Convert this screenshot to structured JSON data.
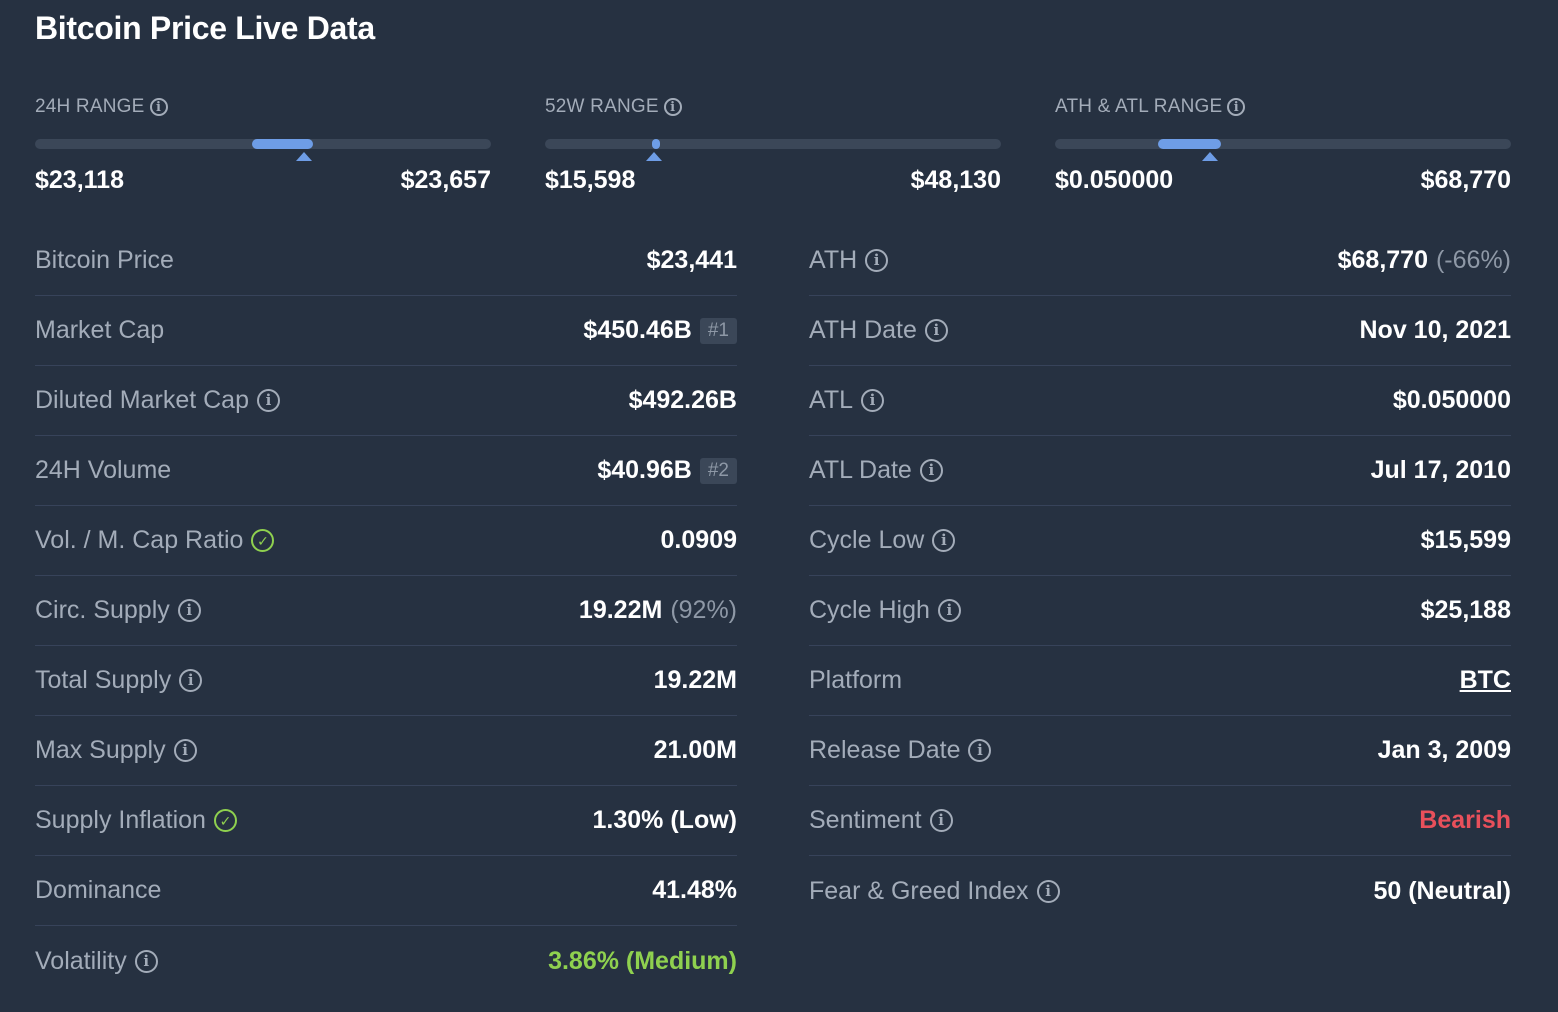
{
  "title": "Bitcoin Price Live Data",
  "ranges": [
    {
      "label": "24H RANGE",
      "low": "$23,118",
      "high": "$23,657",
      "fill_start": 0.475,
      "fill_end": 0.61,
      "marker": 0.59
    },
    {
      "label": "52W RANGE",
      "low": "$15,598",
      "high": "$48,130",
      "fill_start": 0.235,
      "fill_end": 0.25,
      "marker": 0.24
    },
    {
      "label": "ATH & ATL RANGE",
      "low": "$0.050000",
      "high": "$68,770",
      "fill_start": 0.225,
      "fill_end": 0.365,
      "marker": 0.34
    }
  ],
  "accent_color": "#6e9de6",
  "left_rows": [
    {
      "label": "Bitcoin Price",
      "value": "$23,441"
    },
    {
      "label": "Market Cap",
      "value": "$450.46B",
      "badge": "#1"
    },
    {
      "label": "Diluted Market Cap",
      "icon": "info-icon",
      "value": "$492.26B"
    },
    {
      "label": "24H Volume",
      "value": "$40.96B",
      "badge": "#2"
    },
    {
      "label": "Vol. / M. Cap Ratio",
      "icon": "check-circle-icon",
      "value": "0.0909"
    },
    {
      "label": "Circ. Supply",
      "icon": "info-icon",
      "value": "19.22M",
      "extra": "(92%)"
    },
    {
      "label": "Total Supply",
      "icon": "info-icon",
      "value": "19.22M"
    },
    {
      "label": "Max Supply",
      "icon": "info-icon",
      "value": "21.00M"
    },
    {
      "label": "Supply Inflation",
      "icon": "check-circle-icon",
      "value": "1.30% (Low)"
    },
    {
      "label": "Dominance",
      "value": "41.48%"
    },
    {
      "label": "Volatility",
      "icon": "info-icon",
      "value": "3.86% (Medium)",
      "value_color": "#8fd14f"
    }
  ],
  "right_rows": [
    {
      "label": "ATH",
      "icon": "info-icon",
      "value": "$68,770",
      "extra": "(-66%)"
    },
    {
      "label": "ATH Date",
      "icon": "info-icon",
      "value": "Nov 10, 2021"
    },
    {
      "label": "ATL",
      "icon": "info-icon",
      "value": "$0.050000"
    },
    {
      "label": "ATL Date",
      "icon": "info-icon",
      "value": "Jul 17, 2010"
    },
    {
      "label": "Cycle Low",
      "icon": "info-icon",
      "value": "$15,599"
    },
    {
      "label": "Cycle High",
      "icon": "info-icon",
      "value": "$25,188"
    },
    {
      "label": "Platform",
      "value": "BTC",
      "link": true
    },
    {
      "label": "Release Date",
      "icon": "info-icon",
      "value": "Jan 3, 2009"
    },
    {
      "label": "Sentiment",
      "icon": "info-icon",
      "value": "Bearish",
      "value_color": "#e8505b"
    },
    {
      "label": "Fear & Greed Index",
      "icon": "info-icon",
      "value": "50 (Neutral)"
    }
  ]
}
